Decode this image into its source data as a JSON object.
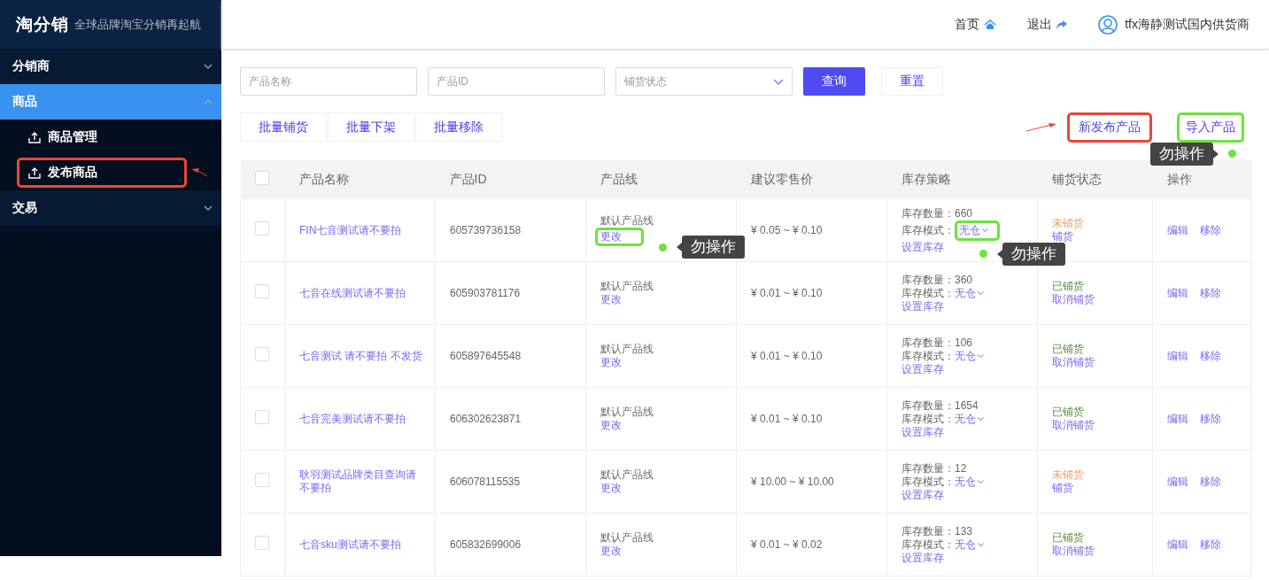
{
  "brand": {
    "logo": "淘分销",
    "slogan": "全球品牌淘宝分销再起航"
  },
  "sidebar": {
    "items": [
      {
        "label": "分销商",
        "expanded": false,
        "selected": false
      },
      {
        "label": "商品",
        "expanded": true,
        "selected": true,
        "children": [
          {
            "label": "商品管理",
            "selected": false
          },
          {
            "label": "发布商品",
            "selected": false,
            "pointed": true
          }
        ]
      },
      {
        "label": "交易",
        "expanded": false,
        "selected": false
      }
    ]
  },
  "header": {
    "home": "首页",
    "logout": "退出",
    "user": "tfx海静测试国内供货商"
  },
  "filters": {
    "name": {
      "placeholder": "产品名称"
    },
    "id": {
      "placeholder": "产品ID"
    },
    "status": {
      "placeholder": "铺货状态"
    },
    "search": "查询",
    "reset": "重置"
  },
  "toolbar": {
    "batch": [
      "批量铺货",
      "批量下架",
      "批量移除"
    ],
    "publish": {
      "label": "新发布产品",
      "pointed": true
    },
    "import": {
      "label": "导入产品",
      "blocked": true,
      "note": "勿操作"
    }
  },
  "table": {
    "select_all": false,
    "columns": [
      "产品名称",
      "产品ID",
      "产品线",
      "建议零售价",
      "库存策略",
      "铺货状态",
      "操作"
    ],
    "rows": [
      {
        "selected": false,
        "name": "FIN七音测试请不要拍",
        "id": "605739736158",
        "line": "默认产品线",
        "line_action": "更改",
        "line_blocked": true,
        "line_note": "勿操作",
        "price": "¥ 0.05 ~ ¥ 0.10",
        "qty_label": "库存数量：",
        "qty": "660",
        "mode_label": "库存模式：",
        "mode": "无仓",
        "mode_blocked": true,
        "mode_note": "勿操作",
        "stock_action": "设置库存",
        "status": "未铺货",
        "listed": false,
        "status_action": "铺货",
        "actions": [
          "编辑",
          "移除"
        ]
      },
      {
        "selected": false,
        "name": "七音在线测试请不要拍",
        "id": "605903781176",
        "line": "默认产品线",
        "line_action": "更改",
        "price": "¥ 0.01 ~ ¥ 0.10",
        "qty_label": "库存数量：",
        "qty": "360",
        "mode_label": "库存模式：",
        "mode": "无仓",
        "stock_action": "设置库存",
        "status": "已铺货",
        "listed": true,
        "status_action": "取消铺货",
        "actions": [
          "编辑",
          "移除"
        ]
      },
      {
        "selected": false,
        "name": "七音测试 请不要拍 不发货",
        "id": "605897645548",
        "line": "默认产品线",
        "line_action": "更改",
        "price": "¥ 0.01 ~ ¥ 0.10",
        "qty_label": "库存数量：",
        "qty": "106",
        "mode_label": "库存模式：",
        "mode": "无仓",
        "stock_action": "设置库存",
        "status": "已铺货",
        "listed": true,
        "status_action": "取消铺货",
        "actions": [
          "编辑",
          "移除"
        ]
      },
      {
        "selected": false,
        "name": "七音完美测试请不要拍",
        "id": "606302623871",
        "line": "默认产品线",
        "line_action": "更改",
        "price": "¥ 0.01 ~ ¥ 0.10",
        "qty_label": "库存数量：",
        "qty": "1654",
        "mode_label": "库存模式：",
        "mode": "无仓",
        "stock_action": "设置库存",
        "status": "已铺货",
        "listed": true,
        "status_action": "取消铺货",
        "actions": [
          "编辑",
          "移除"
        ]
      },
      {
        "selected": false,
        "name": "耿羽测试品牌类目查询请不要拍",
        "id": "606078115535",
        "line": "默认产品线",
        "line_action": "更改",
        "price": "¥ 10.00 ~ ¥ 10.00",
        "qty_label": "库存数量：",
        "qty": "12",
        "mode_label": "库存模式：",
        "mode": "无仓",
        "stock_action": "设置库存",
        "status": "未铺货",
        "listed": false,
        "status_action": "铺货",
        "actions": [
          "编辑",
          "移除"
        ]
      },
      {
        "selected": false,
        "name": "七音sku测试请不要拍",
        "id": "605832699006",
        "line": "默认产品线",
        "line_action": "更改",
        "price": "¥ 0.01 ~ ¥ 0.02",
        "qty_label": "库存数量：",
        "qty": "133",
        "mode_label": "库存模式：",
        "mode": "无仓",
        "stock_action": "设置库存",
        "status": "已铺货",
        "listed": true,
        "status_action": "取消铺货",
        "actions": [
          "编辑",
          "移除"
        ]
      }
    ]
  }
}
